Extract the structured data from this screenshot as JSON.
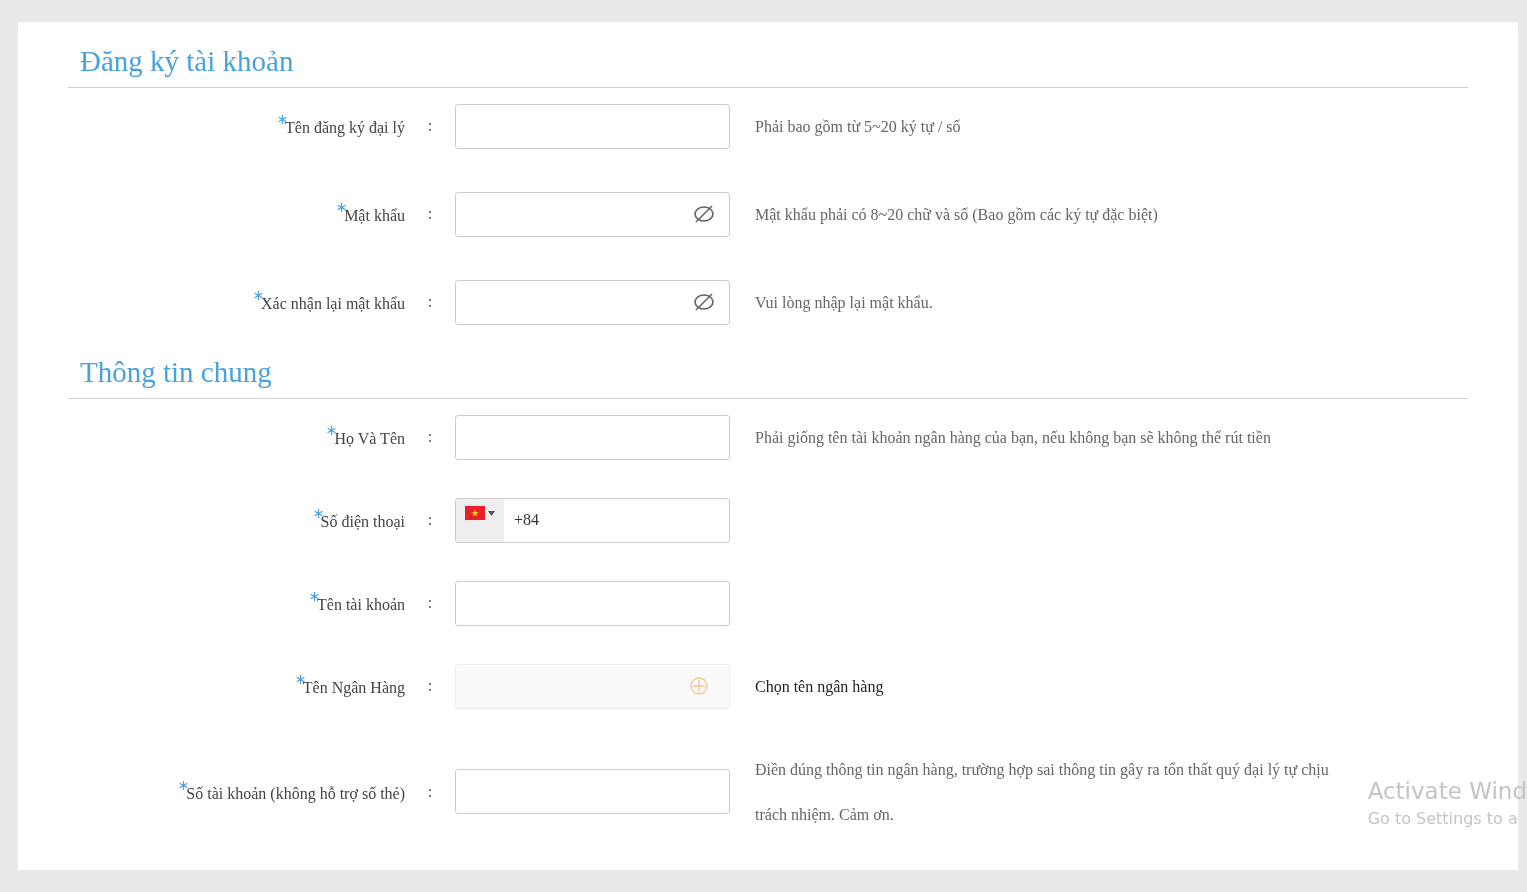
{
  "sections": [
    {
      "title": "Đăng ký tài khoản",
      "fields": [
        {
          "kind": "text",
          "label": "Tên đăng ký đại lý",
          "required": true,
          "separator": ":",
          "hint": "Phải bao gồm từ 5~20 ký tự / số",
          "hint_dark": false
        },
        {
          "kind": "password",
          "label": "Mật khẩu",
          "required": true,
          "separator": ":",
          "hint": "Mật khẩu phải có 8~20 chữ và số (Bao gồm các ký tự đặc biệt)",
          "hint_dark": false
        },
        {
          "kind": "password",
          "label": "Xác nhận lại mật khẩu",
          "required": true,
          "separator": ":",
          "hint": "Vui lòng nhập lại mật khẩu.",
          "hint_dark": false
        }
      ]
    },
    {
      "title": "Thông tin chung",
      "fields": [
        {
          "kind": "text",
          "label": "Họ Và Tên",
          "required": true,
          "separator": ":",
          "hint": "Phải giống tên tài khoản ngân hàng của bạn, nếu không bạn sẽ không thể rút tiền",
          "hint_dark": false
        },
        {
          "kind": "phone",
          "label": "Số điện thoại",
          "required": true,
          "separator": ":",
          "value": "+84"
        },
        {
          "kind": "text",
          "label": "Tên tài khoản",
          "required": true,
          "separator": ":"
        },
        {
          "kind": "select",
          "label": "Tên Ngân Hàng",
          "required": true,
          "disabled": true,
          "separator": ":",
          "hint": "Chọn tên ngân hàng",
          "hint_dark": true
        },
        {
          "kind": "text",
          "label": "Số tài khoản (không hỗ trợ số thẻ)",
          "required": true,
          "separator": ":",
          "hint": "Điền đúng thông tin ngân hàng, trường hợp sai thông tin gây ra tổn thất quý đại lý tự chịu trách nhiệm. Cảm ơn.",
          "hint_dark": false
        }
      ]
    }
  ],
  "os_notice": {
    "title": "Activate Wind",
    "subtitle": "Go to Settings to a"
  }
}
